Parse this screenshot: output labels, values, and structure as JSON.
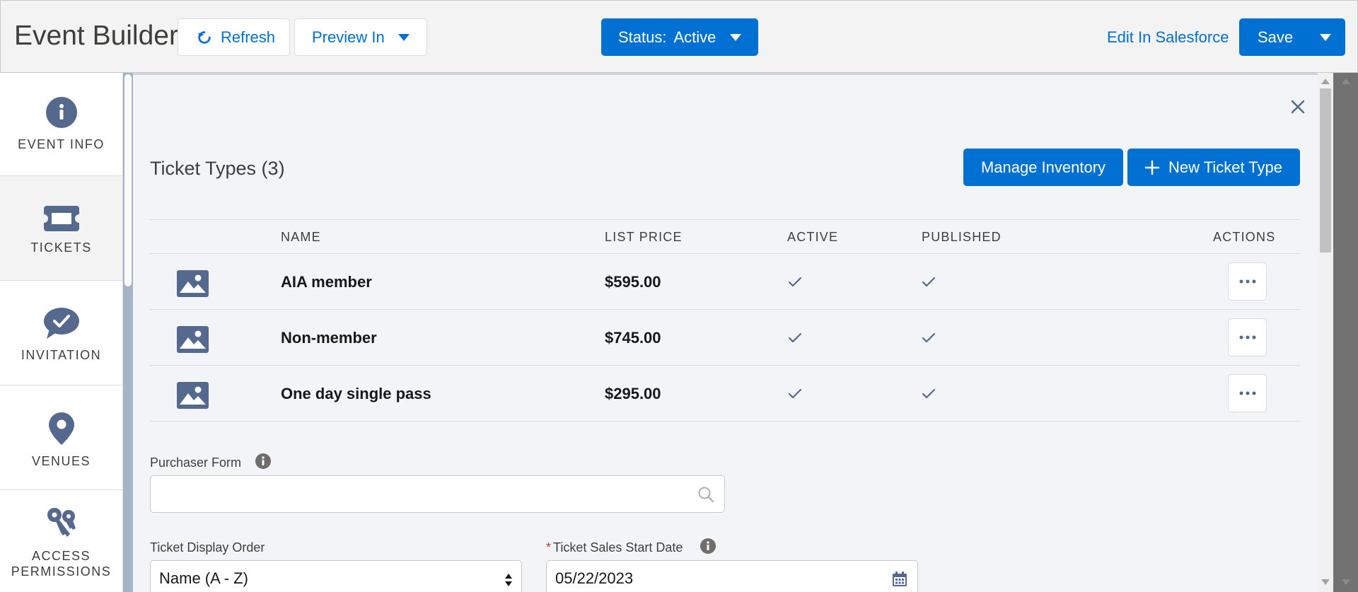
{
  "header": {
    "title": "Event Builder",
    "refresh_label": "Refresh",
    "preview_label": "Preview In",
    "status_label": "Status:",
    "status_value": "Active",
    "edit_link": "Edit In Salesforce",
    "save_label": "Save"
  },
  "sidebar": {
    "items": [
      {
        "label": "EVENT INFO",
        "icon": "info-icon"
      },
      {
        "label": "TICKETS",
        "icon": "ticket-icon",
        "active": true
      },
      {
        "label": "INVITATION",
        "icon": "chat-check-icon"
      },
      {
        "label": "VENUES",
        "icon": "location-pin-icon"
      },
      {
        "label": "ACCESS PERMISSIONS",
        "icon": "keys-icon"
      }
    ]
  },
  "main": {
    "section_title": "Ticket Types (3)",
    "manage_inventory_label": "Manage Inventory",
    "new_ticket_type_label": "New Ticket Type",
    "table": {
      "columns": [
        "NAME",
        "LIST PRICE",
        "ACTIVE",
        "PUBLISHED",
        "ACTIONS"
      ],
      "rows": [
        {
          "name": "AIA member",
          "price": "$595.00",
          "active": true,
          "published": true
        },
        {
          "name": "Non-member",
          "price": "$745.00",
          "active": true,
          "published": true
        },
        {
          "name": "One day single pass",
          "price": "$295.00",
          "active": true,
          "published": true
        }
      ]
    },
    "purchaser_form": {
      "label": "Purchaser Form",
      "value": ""
    },
    "ticket_display_order": {
      "label": "Ticket Display Order",
      "value": "Name (A - Z)"
    },
    "ticket_sales_start_date": {
      "required_marker": "*",
      "label": "Ticket Sales Start Date",
      "value": "05/22/2023"
    }
  },
  "colors": {
    "brand": "#0070d2",
    "icon": "#54698d",
    "sidebar_gutter": "#a5b4c6"
  }
}
